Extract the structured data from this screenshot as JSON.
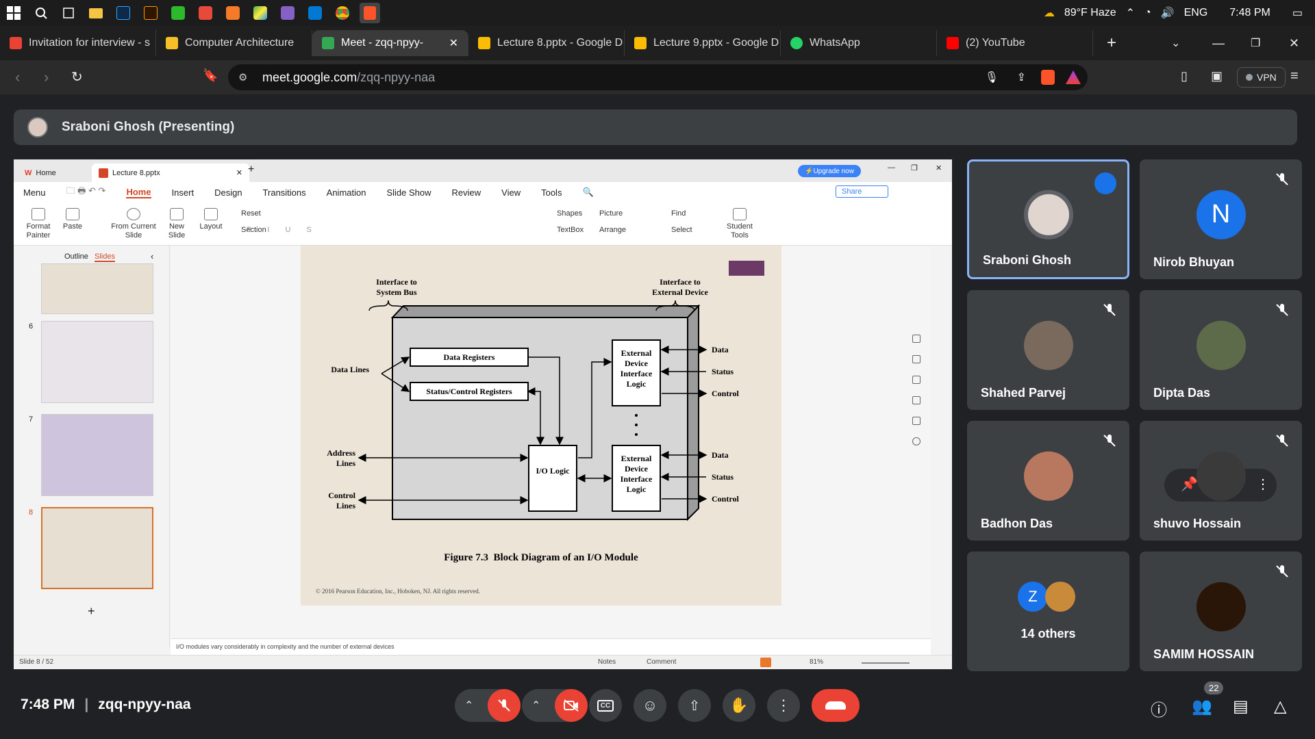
{
  "taskbar": {
    "weather": "89°F Haze",
    "language": "ENG",
    "time": "7:48 PM"
  },
  "browser": {
    "tabs": [
      {
        "label": "Invitation for interview - s",
        "color": "#ea4335"
      },
      {
        "label": "Computer Architecture",
        "color": "#f6c026"
      },
      {
        "label": "Meet - zqq-npyy-",
        "color": "#34a853"
      },
      {
        "label": "Lecture 8.pptx - Google D",
        "color": "#fbbc04"
      },
      {
        "label": "Lecture 9.pptx - Google D",
        "color": "#fbbc04"
      },
      {
        "label": "WhatsApp",
        "color": "#25d366"
      },
      {
        "label": "(2) YouTube",
        "color": "#ff0000"
      }
    ],
    "url_host": "meet.google.com",
    "url_path": "/zqq-npyy-naa",
    "vpn": "VPN"
  },
  "presenter": {
    "label": "Sraboni Ghosh (Presenting)"
  },
  "wps": {
    "home_tab": "Home",
    "doc_tab": "Lecture 8.pptx",
    "upgrade": "Upgrade now",
    "menu_items": [
      "Menu",
      "Home",
      "Insert",
      "Design",
      "Transitions",
      "Animation",
      "Slide Show",
      "Review",
      "View",
      "Tools"
    ],
    "share": "Share",
    "ribbon": {
      "format_painter": "Format Painter",
      "paste": "Paste",
      "from_current": "From Current Slide",
      "new_slide": "New Slide",
      "layout": "Layout",
      "reset": "Reset",
      "section": "Section",
      "shapes": "Shapes",
      "picture": "Picture",
      "textbox": "TextBox",
      "arrange": "Arrange",
      "find": "Find",
      "select": "Select",
      "student_tools": "Student Tools"
    },
    "panel_tabs": [
      "Outline",
      "Slides"
    ],
    "slide_numbers": [
      "6",
      "7",
      "8"
    ],
    "notes": "I/O modules vary considerably in complexity and the number of external devices",
    "status_slide": "Slide 8 / 52",
    "status_notes": "Notes",
    "status_comment": "Comment",
    "zoom": "81%"
  },
  "slide": {
    "interface_bus": "Interface to System Bus",
    "interface_ext": "Interface to External Device",
    "data_registers": "Data Registers",
    "status_registers": "Status/Control Registers",
    "data_lines": "Data Lines",
    "address_lines": "Address Lines",
    "control_lines": "Control Lines",
    "io_logic": "I/O Logic",
    "ext_logic": "External Device Interface Logic",
    "data": "Data",
    "status": "Status",
    "control": "Control",
    "caption": "Figure 7.3  Block Diagram of an I/O Module",
    "copyright": "© 2016 Pearson Education, Inc., Hoboken, NJ. All rights reserved."
  },
  "participants": [
    {
      "name": "Sraboni Ghosh",
      "speaking": true
    },
    {
      "name": "Nirob Bhuyan",
      "initial": "N",
      "color": "#1a73e8"
    },
    {
      "name": "Shahed Parvej"
    },
    {
      "name": "Dipta Das"
    },
    {
      "name": "Badhon Das"
    },
    {
      "name": "shuvo Hossain"
    },
    {
      "name": "14 others",
      "initial": "Z",
      "color": "#1a73e8"
    },
    {
      "name": "SAMIM HOSSAIN"
    }
  ],
  "meeting": {
    "time": "7:48 PM",
    "code": "zqq-npyy-naa",
    "participant_count": "22"
  }
}
